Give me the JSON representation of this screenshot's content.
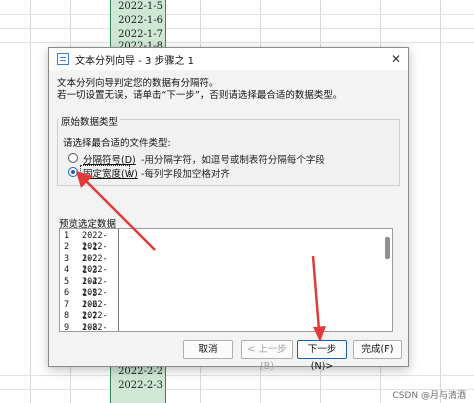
{
  "sheet": {
    "cells_top": [
      "2022-1-5",
      "2022-1-6",
      "2022-1-7",
      "2022-1-8"
    ],
    "cells_bottom": [
      "2022-2-2",
      "2022-2-3"
    ]
  },
  "dialog": {
    "title": "文本分列向导 - 3 步骤之 1",
    "close_glyph": "✕",
    "intro_line1": "文本分列向导判定您的数据有分隔符。",
    "intro_line2": "若一切设置无误，请单击“下一步”，否则请选择最合适的数据类型。",
    "group_title": "原始数据类型",
    "group_prompt": "请选择最合适的文件类型:",
    "options": [
      {
        "label": "分隔符号(D)",
        "description": "-用分隔字符，如逗号或制表符分隔每个字段",
        "checked": false
      },
      {
        "label": "固定宽度(W)",
        "description": "-每列字段加空格对齐",
        "checked": true
      }
    ],
    "preview_title": "预览选定数据",
    "preview_rows": [
      {
        "num": "1",
        "value": "2022-1-1"
      },
      {
        "num": "2",
        "value": "2022-1-2"
      },
      {
        "num": "3",
        "value": "2022-1-3"
      },
      {
        "num": "4",
        "value": "2022-1-4"
      },
      {
        "num": "5",
        "value": "2022-1-5"
      },
      {
        "num": "6",
        "value": "2022-1-6"
      },
      {
        "num": "7",
        "value": "2022-1-7"
      },
      {
        "num": "8",
        "value": "2022-1-8"
      },
      {
        "num": "9",
        "value": "2022-1-9"
      }
    ],
    "buttons": {
      "cancel": "取消",
      "back": "< 上一步(B)",
      "next": "下一步(N)>",
      "finish": "完成(F)"
    }
  },
  "watermark": "CSDN @月与清酒",
  "colors": {
    "selected_column": "#cfe8d5",
    "selected_column_border": "#2e8b57",
    "accent": "#1a5fb4",
    "annotation_arrow": "#e03a3a"
  }
}
